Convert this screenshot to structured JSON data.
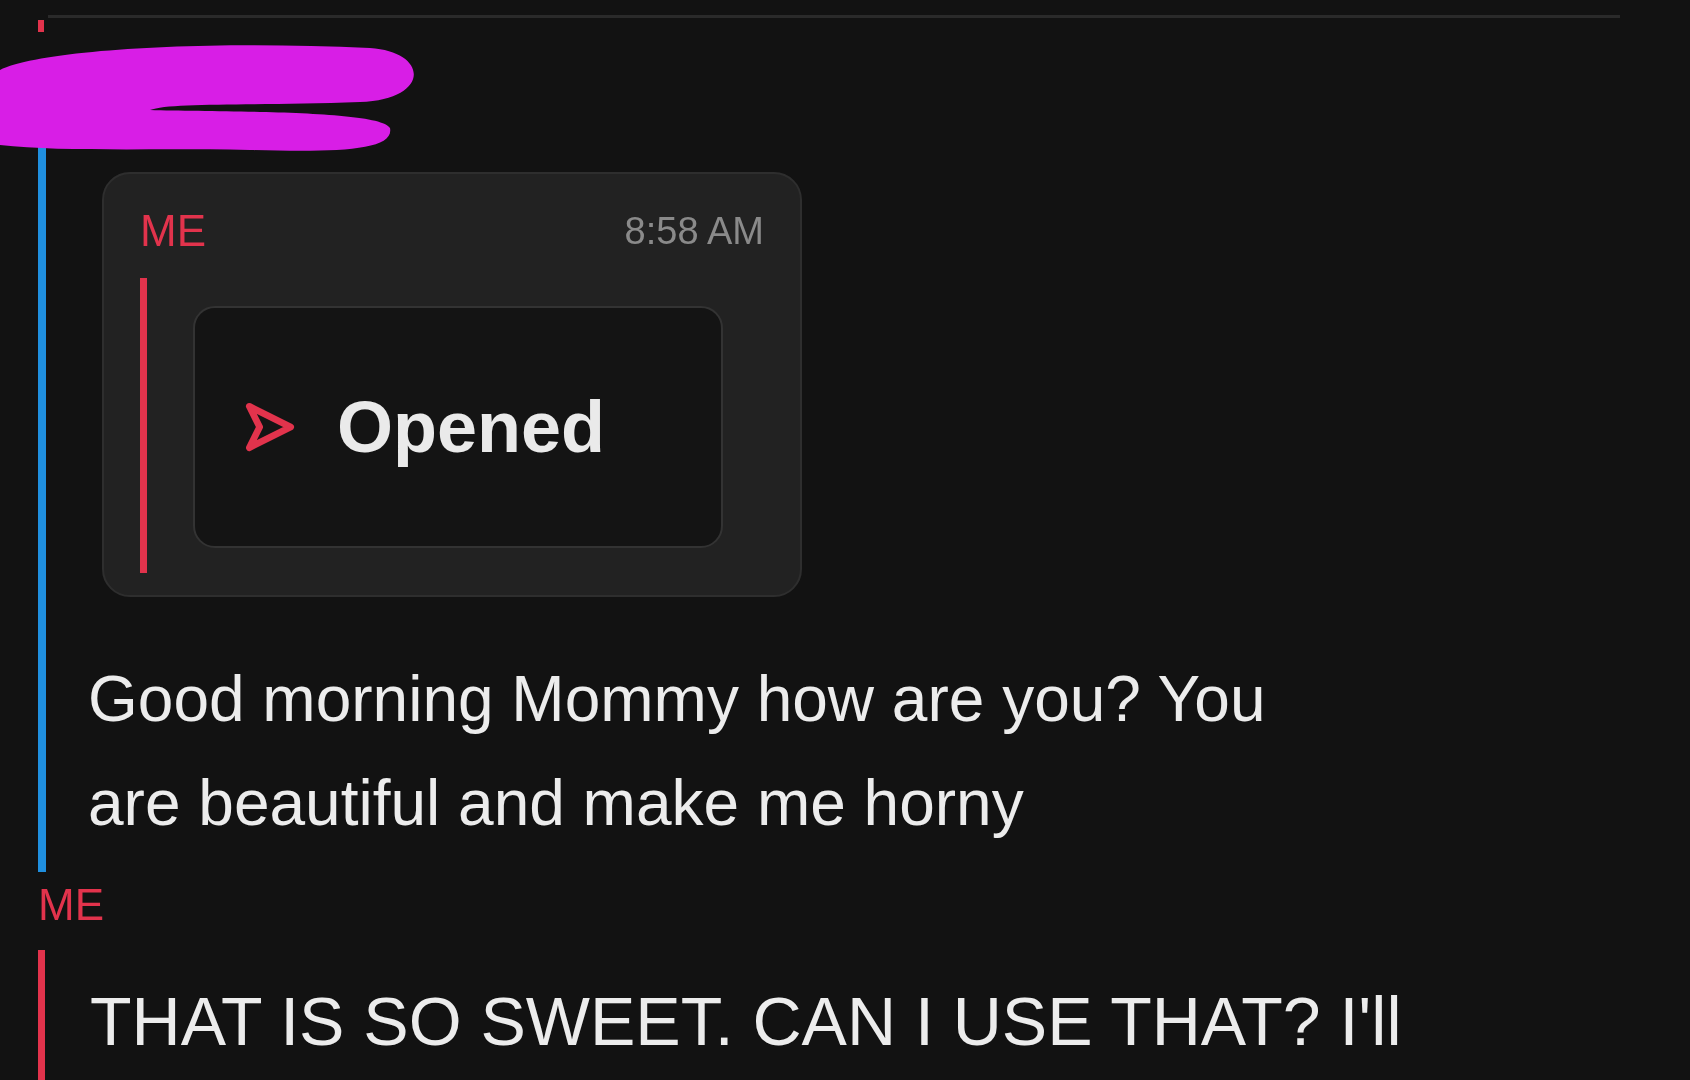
{
  "quoted_message": {
    "sender": "ME",
    "time": "8:58 AM",
    "status": "Opened"
  },
  "received_message": {
    "text": "Good morning Mommy how are you? You are beautiful and make me horny"
  },
  "reply": {
    "sender": "ME",
    "text": "THAT IS SO SWEET. CAN I USE THAT? I'll"
  }
}
